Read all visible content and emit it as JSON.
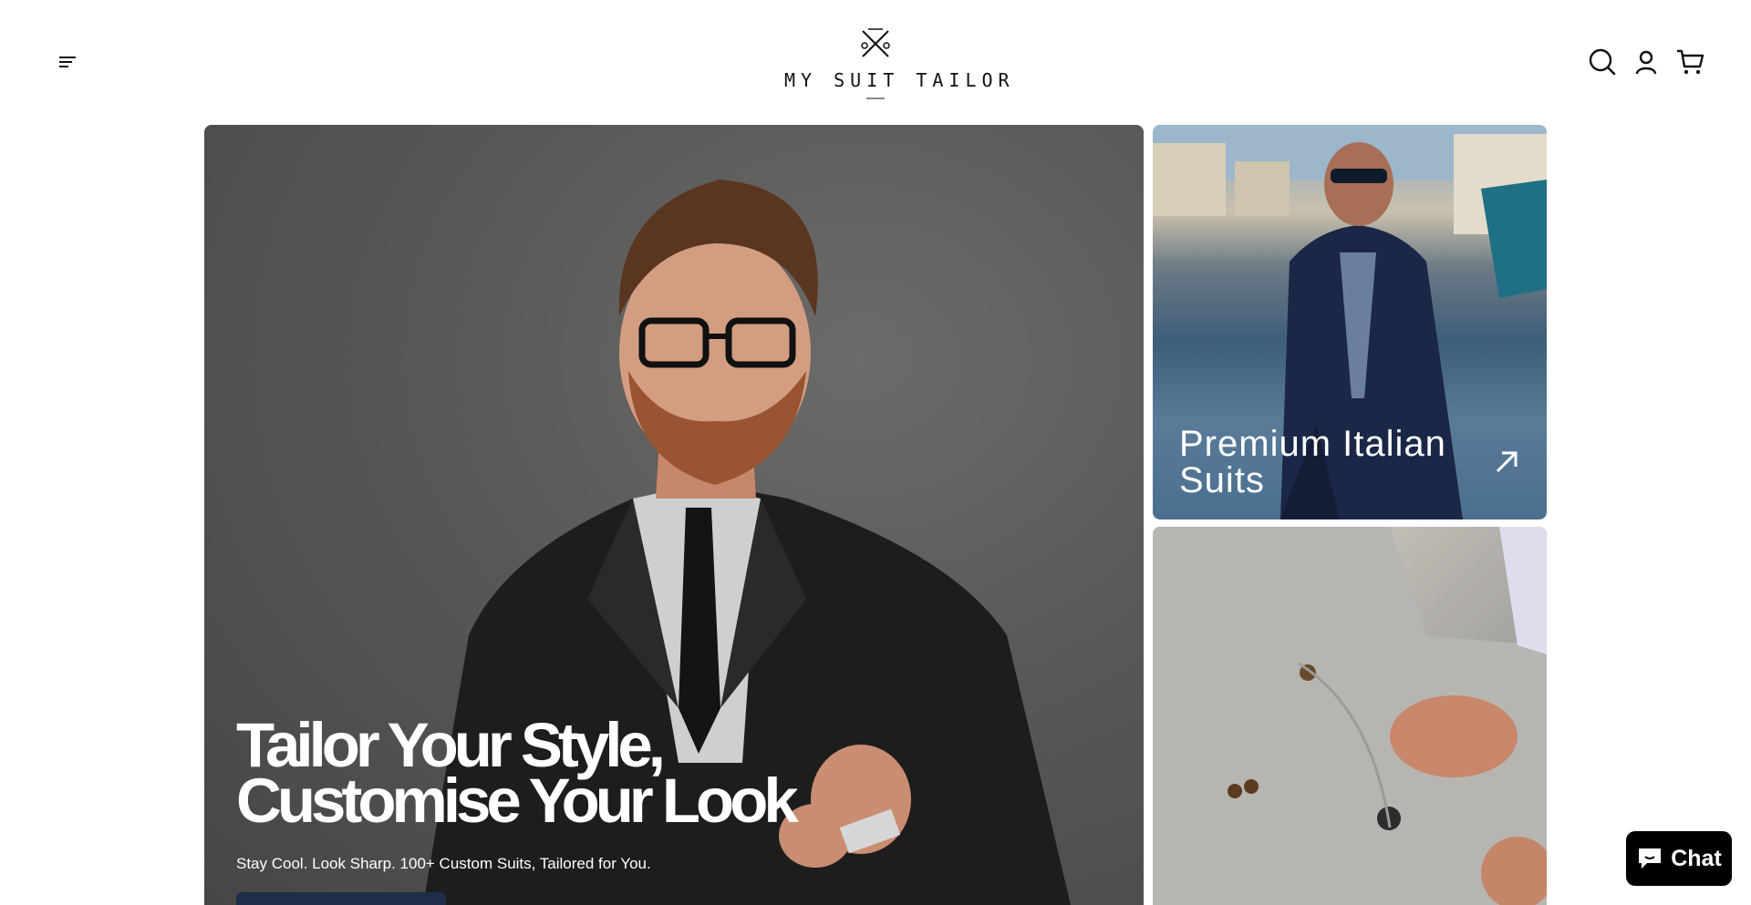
{
  "header": {
    "brand": "MY SUIT TAILOR",
    "icons": [
      "menu-icon",
      "search-icon",
      "account-icon",
      "cart-icon"
    ]
  },
  "hero": {
    "title_line1": "Tailor Your Style,",
    "title_line2": "Customise Your Look",
    "subtitle": "Stay Cool. Look Sharp. 100+ Custom Suits, Tailored for You.",
    "cta_color": "#1f2d4a"
  },
  "cards": [
    {
      "label": "Premium Italian Suits",
      "icon": "arrow-up-right-icon"
    },
    {
      "label": ""
    }
  ],
  "chat": {
    "label": "Chat",
    "icon": "chat-bubble-icon"
  }
}
